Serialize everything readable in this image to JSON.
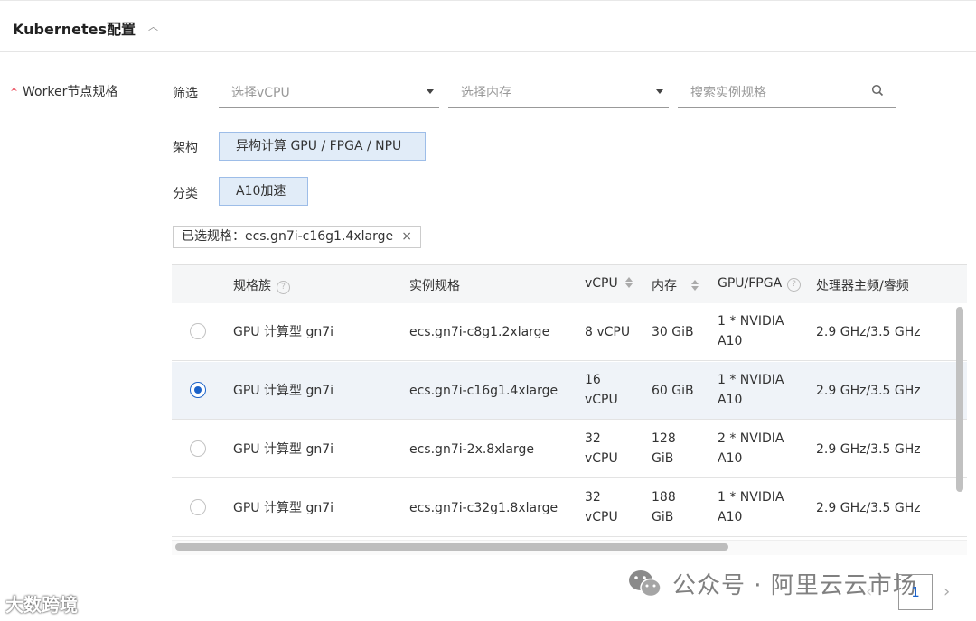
{
  "header": {
    "title": "Kubernetes配置"
  },
  "form": {
    "required_mark": "*",
    "worker_label": "Worker节点规格",
    "filter_label": "筛选",
    "vcpu_placeholder": "选择vCPU",
    "memory_placeholder": "选择内存",
    "search_placeholder": "搜索实例规格",
    "arch_label": "架构",
    "arch_value": "异构计算 GPU / FPGA / NPU",
    "category_label": "分类",
    "category_value": "A10加速",
    "selected_prefix": "已选规格：",
    "selected_value": "ecs.gn7i-c16g1.4xlarge",
    "selected_close": "×"
  },
  "table": {
    "headers": {
      "family": "规格族",
      "instance": "实例规格",
      "vcpu": "vCPU",
      "memory": "内存",
      "gpu": "GPU/FPGA",
      "cpu_freq": "处理器主频/睿频"
    },
    "rows": [
      {
        "selected": false,
        "family": "GPU 计算型 gn7i",
        "instance": "ecs.gn7i-c8g1.2xlarge",
        "vcpu_1": "8 vCPU",
        "vcpu_2": "",
        "mem_1": "30 GiB",
        "mem_2": "",
        "gpu_1": "1 * NVIDIA",
        "gpu_2": "A10",
        "freq": "2.9 GHz/3.5 GHz"
      },
      {
        "selected": true,
        "family": "GPU 计算型 gn7i",
        "instance": "ecs.gn7i-c16g1.4xlarge",
        "vcpu_1": "16",
        "vcpu_2": "vCPU",
        "mem_1": "60 GiB",
        "mem_2": "",
        "gpu_1": "1 * NVIDIA",
        "gpu_2": "A10",
        "freq": "2.9 GHz/3.5 GHz"
      },
      {
        "selected": false,
        "family": "GPU 计算型 gn7i",
        "instance": "ecs.gn7i-2x.8xlarge",
        "vcpu_1": "32",
        "vcpu_2": "vCPU",
        "mem_1": "128",
        "mem_2": "GiB",
        "gpu_1": "2 * NVIDIA",
        "gpu_2": "A10",
        "freq": "2.9 GHz/3.5 GHz"
      },
      {
        "selected": false,
        "family": "GPU 计算型 gn7i",
        "instance": "ecs.gn7i-c32g1.8xlarge",
        "vcpu_1": "32",
        "vcpu_2": "vCPU",
        "mem_1": "188",
        "mem_2": "GiB",
        "gpu_1": "1 * NVIDIA",
        "gpu_2": "A10",
        "freq": "2.9 GHz/3.5 GHz"
      }
    ]
  },
  "pagination": {
    "current_page": "1",
    "prev": "‹",
    "next": "›"
  },
  "watermark": {
    "text": "公众号 · 阿里云云市场",
    "corner_logo": "大数跨境"
  },
  "colors": {
    "accent": "#1b62c9",
    "chip_bg": "#e1ecf8",
    "required": "#e6263a"
  }
}
